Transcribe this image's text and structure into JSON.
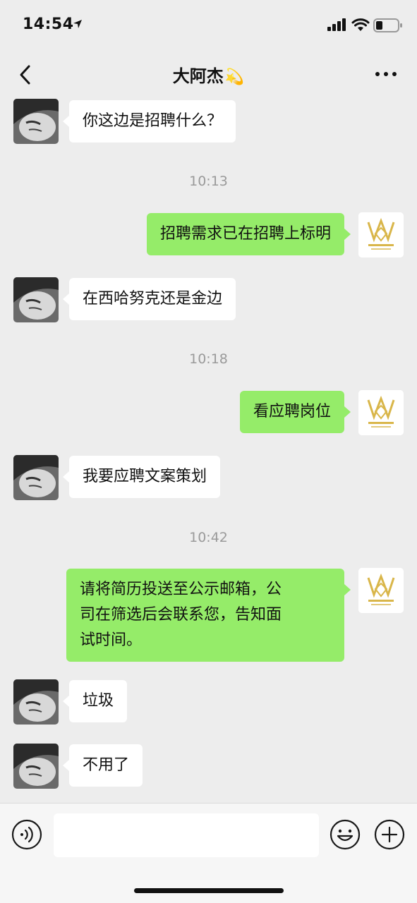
{
  "status_bar": {
    "time": "14:54"
  },
  "header": {
    "title": "大阿杰",
    "title_emoji": "💫"
  },
  "messages": [
    {
      "from": "other",
      "text": "你这边是招聘什么？"
    },
    {
      "type": "time",
      "text": "10:13"
    },
    {
      "from": "me",
      "text": "招聘需求已在招聘上标明"
    },
    {
      "from": "other",
      "text": "在西哈努克还是金边"
    },
    {
      "type": "time",
      "text": "10:18"
    },
    {
      "from": "me",
      "text": "看应聘岗位"
    },
    {
      "from": "other",
      "text": "我要应聘文案策划"
    },
    {
      "type": "time",
      "text": "10:42"
    },
    {
      "from": "me",
      "lines": [
        "请将简历投送至公示邮箱，公",
        "司在筛选后会联系您，告知面",
        "试时间。"
      ]
    },
    {
      "from": "other",
      "text": "垃圾"
    },
    {
      "from": "other",
      "text": "不用了"
    }
  ],
  "input_bar": {
    "value": "",
    "placeholder": ""
  },
  "icons": {
    "back": "chevron-left-icon",
    "more": "more-icon",
    "voice": "voice-icon",
    "emoji": "emoji-icon",
    "plus": "plus-icon"
  },
  "colors": {
    "background": "#ededed",
    "my_bubble": "#95ec69",
    "other_bubble": "#ffffff",
    "timestamp": "#9a9a9a"
  }
}
